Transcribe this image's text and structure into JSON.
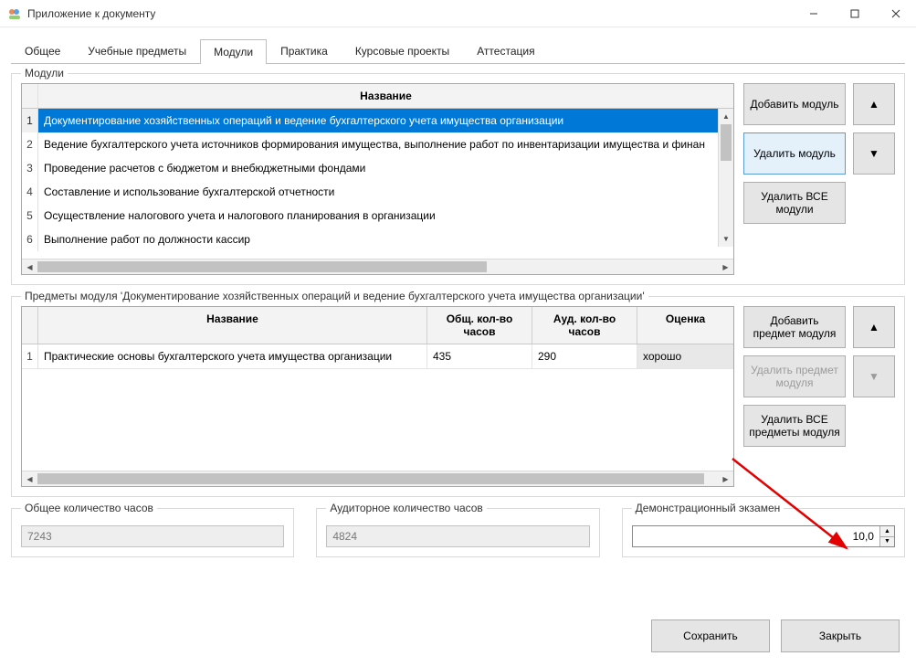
{
  "window": {
    "title": "Приложение к документу"
  },
  "tabs": [
    "Общее",
    "Учебные предметы",
    "Модули",
    "Практика",
    "Курсовые проекты",
    "Аттестация"
  ],
  "activeTab": 2,
  "modulesBox": {
    "legend": "Модули",
    "header": "Название",
    "rows": [
      "Документирование хозяйственных операций и ведение бухгалтерского учета имущества организации",
      "Ведение бухгалтерского учета источников формирования имущества, выполнение работ по инвентаризации имущества и финан",
      "Проведение расчетов с бюджетом и внебюджетными фондами",
      "Составление и использование бухгалтерской отчетности",
      "Осуществление налогового учета и налогового планирования в организации",
      "Выполнение работ по должности кассир"
    ],
    "buttons": {
      "add": "Добавить модуль",
      "del": "Удалить модуль",
      "delAll": "Удалить ВСЕ модули"
    }
  },
  "subjectsBox": {
    "legend": "Предметы модуля 'Документирование хозяйственных операций и ведение бухгалтерского учета имущества организации'",
    "cols": {
      "name": "Название",
      "total": "Общ. кол-во часов",
      "aud": "Ауд. кол-во часов",
      "grade": "Оценка"
    },
    "rows": [
      {
        "name": "Практические основы бухгалтерского учета имущества организации",
        "total": "435",
        "aud": "290",
        "grade": "хорошо"
      }
    ],
    "buttons": {
      "add": "Добавить предмет модуля",
      "del": "Удалить предмет модуля",
      "delAll": "Удалить ВСЕ предметы модуля"
    }
  },
  "totals": {
    "total": {
      "label": "Общее количество часов",
      "value": "7243"
    },
    "aud": {
      "label": "Аудиторное количество часов",
      "value": "4824"
    },
    "demo": {
      "label": "Демонстрационный экзамен",
      "value": "10,0"
    }
  },
  "footer": {
    "save": "Сохранить",
    "close": "Закрыть"
  },
  "glyphs": {
    "up": "▲",
    "down": "▼",
    "left": "◀",
    "right": "▶"
  }
}
